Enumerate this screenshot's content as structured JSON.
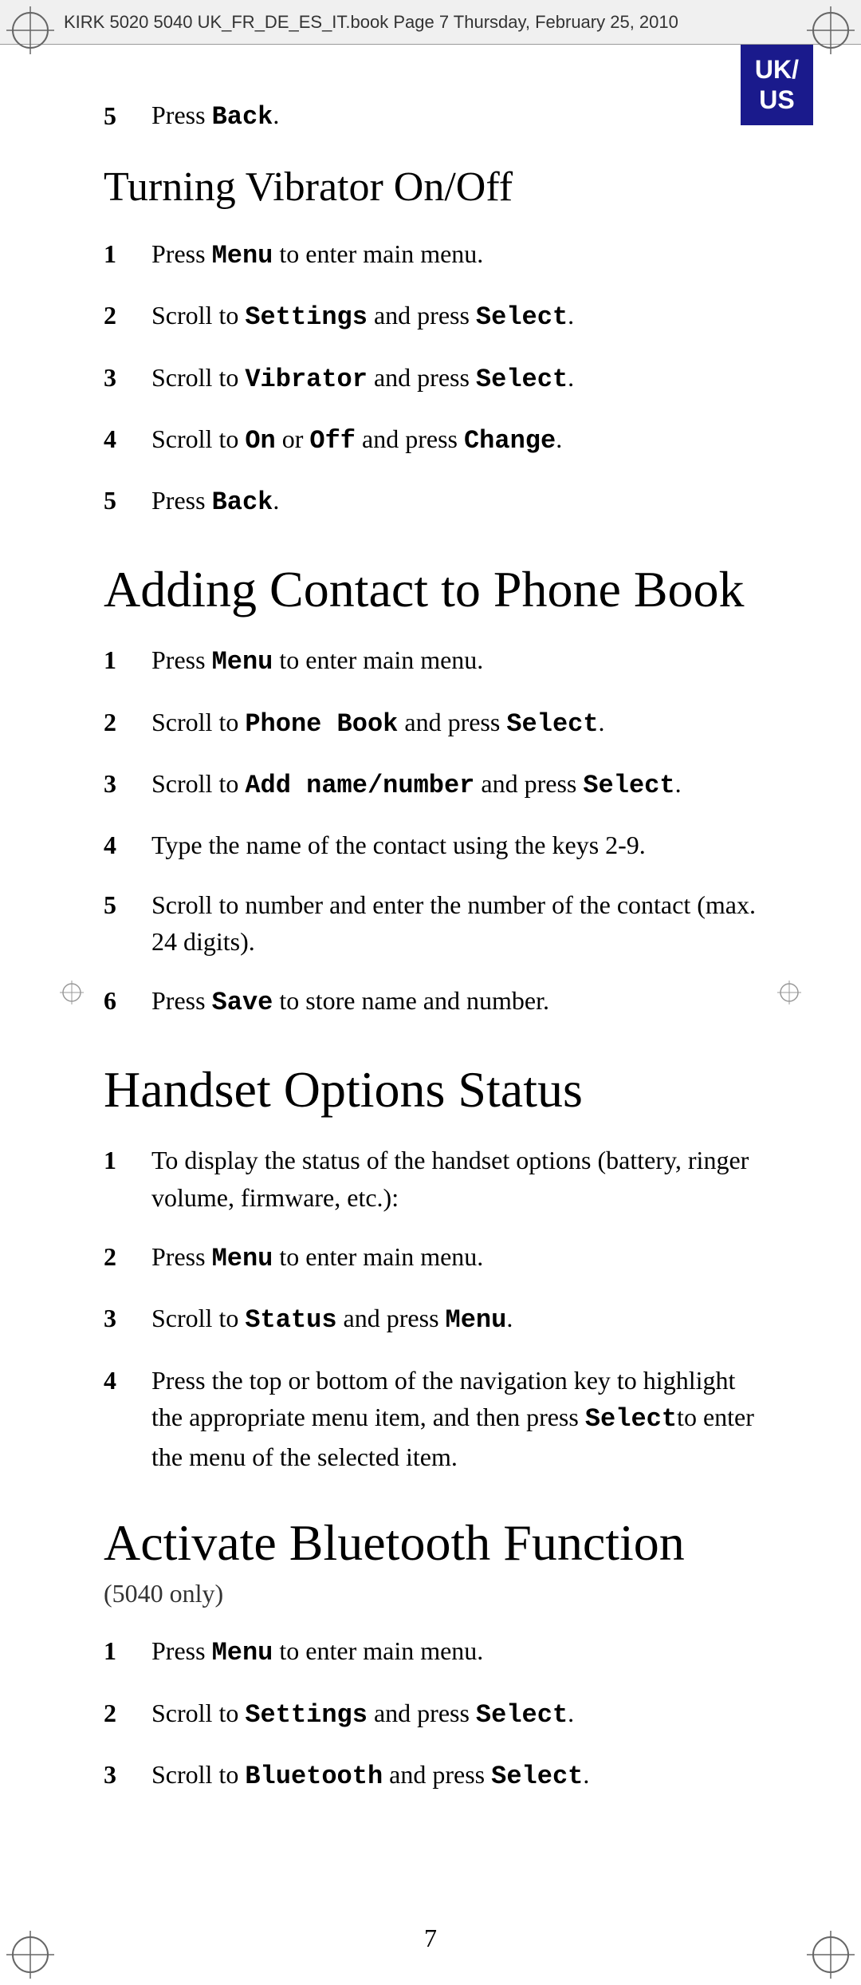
{
  "header": {
    "text": "KIRK 5020 5040 UK_FR_DE_ES_IT.book  Page 7  Thursday, February 25, 2010"
  },
  "badge": {
    "line1": "UK/",
    "line2": "US"
  },
  "page_number": "7",
  "sections": {
    "top_step": {
      "num": "5",
      "text_before": "Press ",
      "bold": "Back",
      "text_after": "."
    },
    "turning_vibrator": {
      "title": "Turning Vibrator On/Off",
      "steps": [
        {
          "num": "1",
          "text": "Press ",
          "bold1": "Menu",
          "text2": " to enter main menu."
        },
        {
          "num": "2",
          "text": "Scroll to ",
          "bold1": "Settings",
          "text2": " and press ",
          "bold2": "Select",
          "text3": "."
        },
        {
          "num": "3",
          "text": "Scroll to ",
          "bold1": "Vibrator",
          "text2": " and press ",
          "bold2": "Select",
          "text3": "."
        },
        {
          "num": "4",
          "text": "Scroll to ",
          "bold1": "On",
          "text2": " or ",
          "bold2": "Off",
          "text3": " and press ",
          "bold3": "Change",
          "text4": "."
        },
        {
          "num": "5",
          "text": "Press ",
          "bold1": "Back",
          "text2": "."
        }
      ]
    },
    "adding_contact": {
      "title": "Adding Contact to Phone Book",
      "steps": [
        {
          "num": "1",
          "parts": [
            {
              "type": "text",
              "val": "Press "
            },
            {
              "type": "bold",
              "val": "Menu"
            },
            {
              "type": "text",
              "val": " to enter main menu."
            }
          ]
        },
        {
          "num": "2",
          "parts": [
            {
              "type": "text",
              "val": "Scroll to "
            },
            {
              "type": "bold",
              "val": "Phone Book"
            },
            {
              "type": "text",
              "val": " and press "
            },
            {
              "type": "bold",
              "val": "Select"
            },
            {
              "type": "text",
              "val": "."
            }
          ]
        },
        {
          "num": "3",
          "parts": [
            {
              "type": "text",
              "val": "Scroll to "
            },
            {
              "type": "bold",
              "val": "Add name/number"
            },
            {
              "type": "text",
              "val": " and press "
            },
            {
              "type": "bold",
              "val": "Select"
            },
            {
              "type": "text",
              "val": "."
            }
          ]
        },
        {
          "num": "4",
          "parts": [
            {
              "type": "text",
              "val": "Type the name of the contact using the keys 2-9."
            }
          ]
        },
        {
          "num": "5",
          "parts": [
            {
              "type": "text",
              "val": "Scroll to number and enter the number of the contact (max. 24 digits)."
            }
          ]
        },
        {
          "num": "6",
          "parts": [
            {
              "type": "text",
              "val": "Press "
            },
            {
              "type": "bold",
              "val": "Save"
            },
            {
              "type": "text",
              "val": " to store name and number."
            }
          ]
        }
      ]
    },
    "handset_options": {
      "title": "Handset Options Status",
      "steps": [
        {
          "num": "1",
          "parts": [
            {
              "type": "text",
              "val": "To display the status of the handset options (battery, ringer volume, firmware, etc.):"
            }
          ]
        },
        {
          "num": "2",
          "parts": [
            {
              "type": "text",
              "val": "Press "
            },
            {
              "type": "bold",
              "val": "Menu"
            },
            {
              "type": "text",
              "val": " to enter main menu."
            }
          ]
        },
        {
          "num": "3",
          "parts": [
            {
              "type": "text",
              "val": "Scroll to "
            },
            {
              "type": "bold",
              "val": "Status"
            },
            {
              "type": "text",
              "val": " and press "
            },
            {
              "type": "bold",
              "val": "Menu"
            },
            {
              "type": "text",
              "val": "."
            }
          ]
        },
        {
          "num": "4",
          "parts": [
            {
              "type": "text",
              "val": "Press the top or bottom of the navigation key to highlight the appropriate menu item, and then press "
            },
            {
              "type": "bold",
              "val": "Select"
            },
            {
              "type": "text",
              "val": "to enter the menu of the selected item."
            }
          ]
        }
      ]
    },
    "activate_bluetooth": {
      "title": "Activate Bluetooth Function",
      "subtitle": "(5040 only)",
      "steps": [
        {
          "num": "1",
          "parts": [
            {
              "type": "text",
              "val": "Press "
            },
            {
              "type": "bold",
              "val": "Menu"
            },
            {
              "type": "text",
              "val": " to enter main menu."
            }
          ]
        },
        {
          "num": "2",
          "parts": [
            {
              "type": "text",
              "val": "Scroll to "
            },
            {
              "type": "bold",
              "val": "Settings"
            },
            {
              "type": "text",
              "val": " and press "
            },
            {
              "type": "bold",
              "val": "Select"
            },
            {
              "type": "text",
              "val": "."
            }
          ]
        },
        {
          "num": "3",
          "parts": [
            {
              "type": "text",
              "val": "Scroll to "
            },
            {
              "type": "bold",
              "val": "Bluetooth"
            },
            {
              "type": "text",
              "val": " and press "
            },
            {
              "type": "bold",
              "val": "Select"
            },
            {
              "type": "text",
              "val": "."
            }
          ]
        }
      ]
    }
  }
}
